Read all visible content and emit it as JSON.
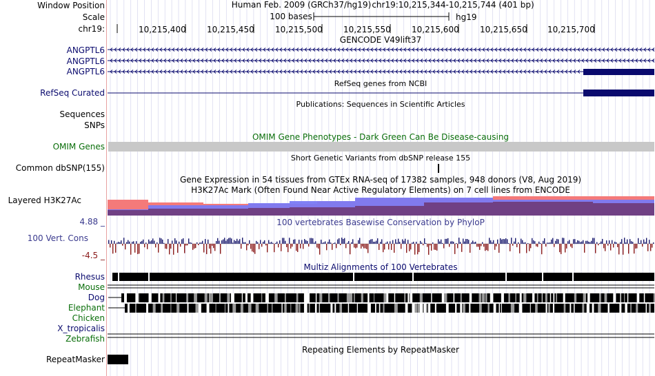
{
  "header": {
    "window_position_label": "Window Position",
    "scale_label": "Scale",
    "chrom_label": "chr19:",
    "assembly": "Human Feb. 2009 (GRCh37/hg19)",
    "position": "chr19:10,215,344-10,215,744 (401 bp)",
    "scale_bar_text": "100 bases",
    "scale_db": "hg19",
    "ticks": [
      "10,215,400",
      "10,215,450",
      "10,215,500",
      "10,215,550",
      "10,215,600",
      "10,215,650",
      "10,215,700"
    ]
  },
  "tracks": {
    "gencode_title": "GENCODE V49lift37",
    "gencode_genes": [
      "ANGPTL6",
      "ANGPTL6",
      "ANGPTL6"
    ],
    "refseq_title": "RefSeq genes from NCBI",
    "refseq_label": "RefSeq Curated",
    "publications_title": "Publications: Sequences in Scientific Articles",
    "sequences_label": "Sequences",
    "snps_label": "SNPs",
    "omim_title": "OMIM Gene Phenotypes - Dark Green Can Be Disease-causing",
    "omim_label": "OMIM Genes",
    "dbsnp_title": "Short Genetic Variants from dbSNP release 155",
    "dbsnp_label": "Common dbSNP(155)",
    "gtex_title": "Gene Expression in 54 tissues from GTEx RNA-seq of 17382 samples, 948 donors (V8, Aug 2019)",
    "h3k27ac_title": "H3K27Ac Mark (Often Found Near Active Regulatory Elements) on 7 cell lines from ENCODE",
    "h3k27ac_label": "Layered H3K27Ac",
    "cons_title": "100 vertebrates Basewise Conservation by PhyloP",
    "cons_label": "100 Vert. Cons",
    "cons_max": "4.88 _",
    "cons_min": "-4.5 _",
    "multiz_title": "Multiz Alignments of 100 Vertebrates",
    "species": [
      "Rhesus",
      "Mouse",
      "Dog",
      "Elephant",
      "Chicken",
      "X_tropicalis",
      "Zebrafish"
    ],
    "repeat_title": "Repeating Elements by RepeatMasker",
    "repeat_label": "RepeatMasker"
  },
  "colors": {
    "gene": "#0a0a6e",
    "label_blue": "#0a0a6e",
    "omim_green": "#0a6e0a",
    "omim_bar": "#c8c8c8",
    "h3_red": "#f47a7a",
    "h3_blue": "#7a7af4",
    "h3_purple": "#6e3a78",
    "cons_pos": "#1a1a6e",
    "cons_neg": "#8a1a1a",
    "cons_label": "#3a3a8e",
    "cons_neg_label": "#8a1a1a",
    "grid": "#d6d6ee"
  }
}
